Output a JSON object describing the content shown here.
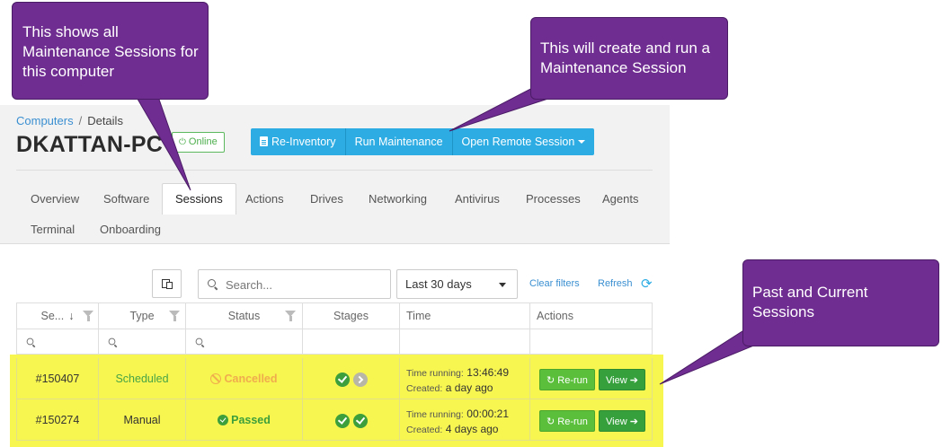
{
  "breadcrumb": {
    "root": "Computers",
    "separator": "/",
    "current": "Details"
  },
  "computer": {
    "name": "DKATTAN-PC",
    "status": "Online"
  },
  "actions": {
    "reinventory": "Re-Inventory",
    "run_maintenance": "Run Maintenance",
    "open_remote": "Open Remote Session"
  },
  "tabs": [
    {
      "label": "Overview"
    },
    {
      "label": "Software"
    },
    {
      "label": "Sessions",
      "active": true
    },
    {
      "label": "Actions"
    },
    {
      "label": "Drives"
    },
    {
      "label": "Networking"
    },
    {
      "label": "Antivirus"
    },
    {
      "label": "Processes"
    },
    {
      "label": "Agents"
    },
    {
      "label": "Terminal"
    },
    {
      "label": "Onboarding"
    }
  ],
  "toolbar": {
    "search_placeholder": "Search...",
    "date_range": "Last 30 days",
    "clear_filters": "Clear filters",
    "refresh": "Refresh"
  },
  "table": {
    "columns": [
      "Se...",
      "Type",
      "Status",
      "Stages",
      "Time",
      "Actions"
    ],
    "rows": [
      {
        "id": "#150407",
        "type": "Scheduled",
        "status": "Cancelled",
        "stages": [
          "done",
          "pending"
        ],
        "time_running_label": "Time running:",
        "time_running": "13:46:49",
        "created_label": "Created:",
        "created": "a day ago",
        "rerun": "Re-run",
        "view": "View"
      },
      {
        "id": "#150274",
        "type": "Manual",
        "status": "Passed",
        "stages": [
          "done",
          "done"
        ],
        "time_running_label": "Time running:",
        "time_running": "00:00:21",
        "created_label": "Created:",
        "created": "4 days ago",
        "rerun": "Re-run",
        "view": "View"
      }
    ]
  },
  "callouts": {
    "sessions": "This shows all Maintenance Sessions for this computer",
    "run": "This will create and run a Maintenance Session",
    "past": "Past and Current Sessions"
  },
  "colors": {
    "callout": "#6f2c91",
    "highlight": "#f7f54f",
    "primary_button": "#2cace3",
    "success": "#3c9f3c",
    "warning": "#f0ad4e"
  }
}
